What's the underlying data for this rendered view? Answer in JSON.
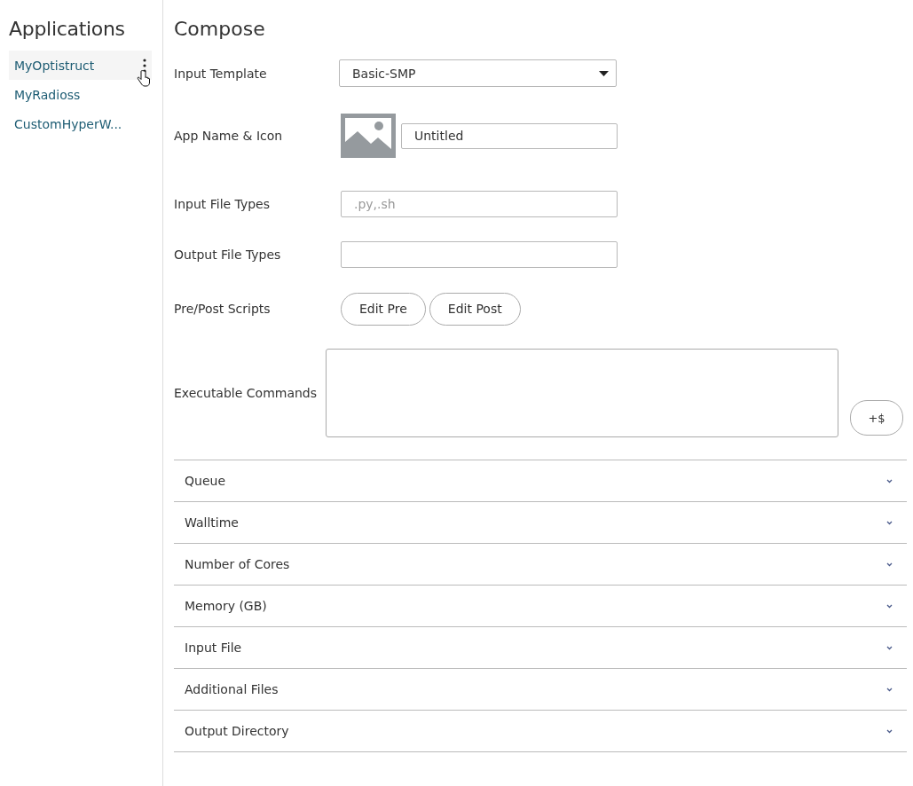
{
  "sidebar": {
    "title": "Applications",
    "items": [
      {
        "label": "MyOptistruct",
        "selected": true
      },
      {
        "label": "MyRadioss",
        "selected": false
      },
      {
        "label": "CustomHyperW...",
        "selected": false
      }
    ]
  },
  "compose": {
    "title": "Compose",
    "fields": [
      {
        "kind": "select",
        "label": "Input Template",
        "value": "Basic-SMP"
      },
      {
        "kind": "name-icon",
        "label": "App Name & Icon",
        "value": "Untitled"
      },
      {
        "kind": "text",
        "label": "Input File Types",
        "placeholder": ".py,.sh"
      },
      {
        "kind": "text",
        "label": "Output File Types"
      },
      {
        "kind": "buttons",
        "label": "Pre/Post Scripts",
        "buttons": [
          "Edit Pre",
          "Edit Post"
        ]
      },
      {
        "kind": "textarea",
        "label": "Executable Commands",
        "button": "+$"
      }
    ]
  },
  "sections": [
    {
      "label": "Queue",
      "expanded": false
    },
    {
      "label": "Walltime",
      "expanded": false
    },
    {
      "label": "Number of Cores",
      "expanded": false
    },
    {
      "label": "Memory (GB)",
      "expanded": false
    },
    {
      "label": "Input File",
      "expanded": false
    },
    {
      "label": "Additional Files",
      "expanded": false
    },
    {
      "label": "Output Directory",
      "expanded": false
    }
  ]
}
